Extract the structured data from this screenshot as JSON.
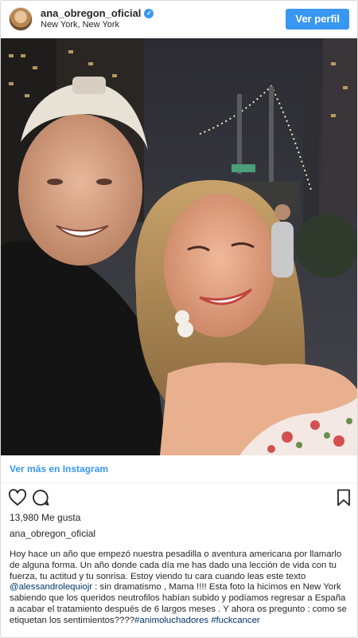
{
  "header": {
    "username": "ana_obregon_oficial",
    "location": "New York, New York",
    "view_profile_label": "Ver perfil",
    "verified_icon": "verified-badge-icon"
  },
  "post": {
    "more_link": "Ver más en Instagram",
    "likes": "13,980 Me gusta",
    "author": "ana_obregon_oficial",
    "caption": {
      "part1": "Hoy hace un año que empezó nuestra pesadilla o aventura americana por llamarlo de alguna forma. Un año donde cada día me has dado una lección de vida con tu fuerza, tu actitud y tu sonrisa. Estoy viendo tu cara cuando leas este texto ",
      "mention": "@alessandrolequiojr",
      "part2": " : sin dramatismo , Mama !!!! Esta foto la hicimos en New York sabiendo que los queridos neutrofilos habían subido y podíamos regresar a España a acabar el tratamiento después de 6 largos meses . Y ahora os pregunto : como se etiquetan los sentimientos????",
      "hashtag1": "#animoluchadores",
      "space": " ",
      "hashtag2": "#fuckcancer"
    },
    "icons": [
      "heart-icon",
      "comment-icon",
      "bookmark-icon"
    ]
  },
  "colors": {
    "accent": "#3897f0",
    "link": "#003569",
    "text": "#262626"
  }
}
